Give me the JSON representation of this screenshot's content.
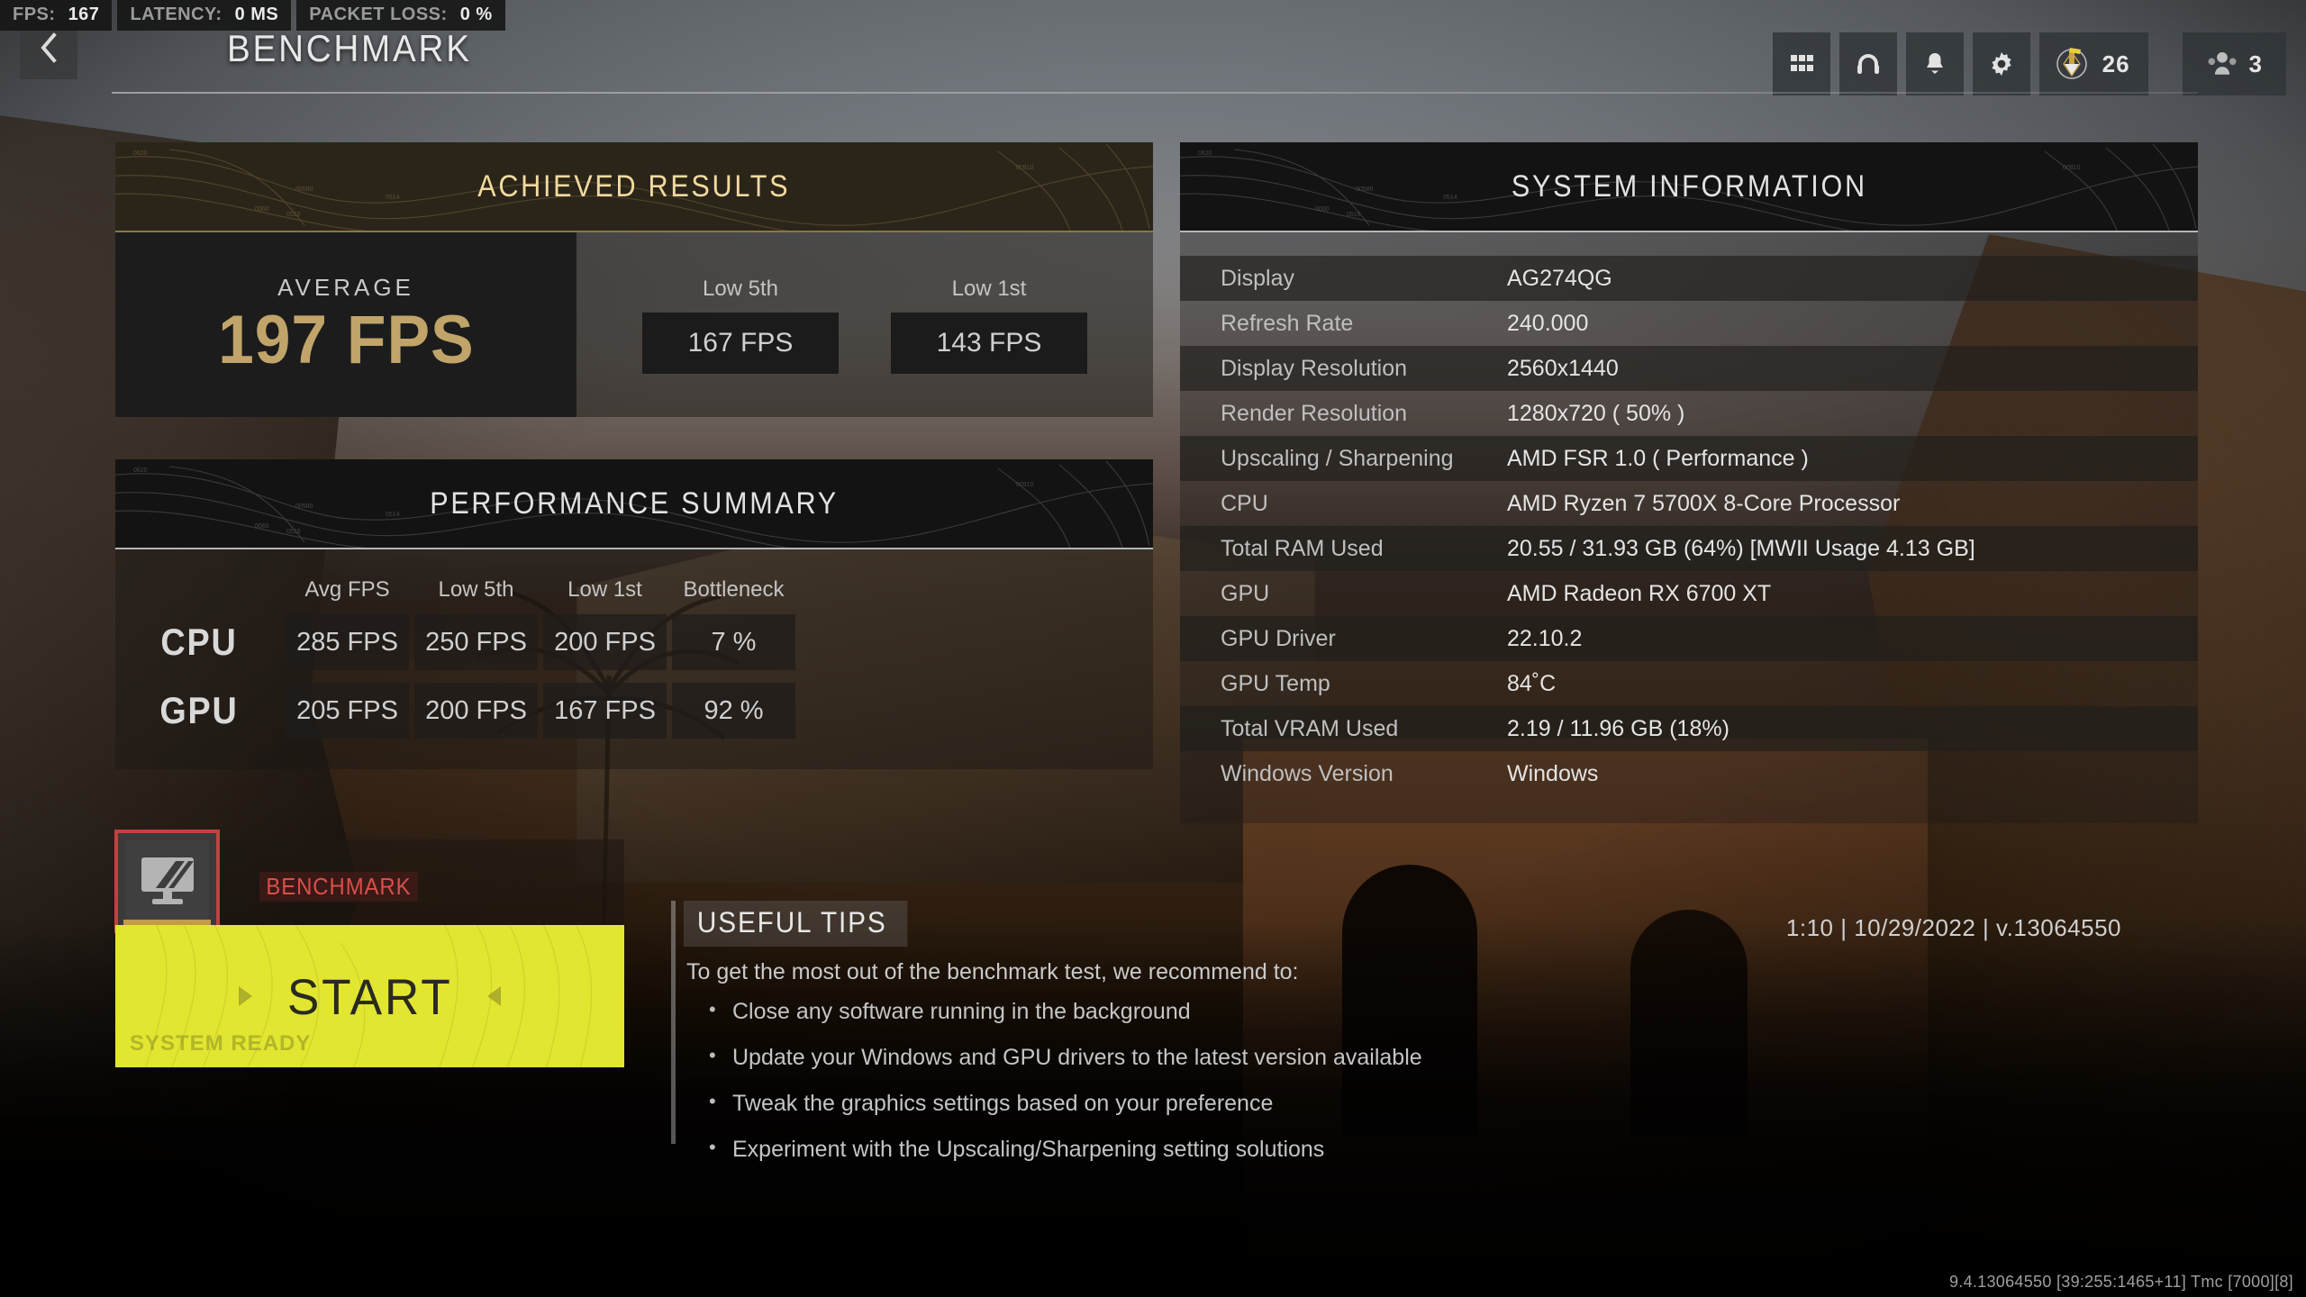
{
  "perf_hud": [
    {
      "label": "FPS:",
      "value": "167"
    },
    {
      "label": "LATENCY:",
      "value": "0 MS"
    },
    {
      "label": "PACKET LOSS:",
      "value": "0 %"
    }
  ],
  "header": {
    "title": "BENCHMARK",
    "back_icon": "chevron-left-icon",
    "icons": [
      {
        "name": "grid-apps-icon"
      },
      {
        "name": "headset-icon"
      },
      {
        "name": "bell-notification-icon"
      },
      {
        "name": "gear-settings-icon"
      }
    ],
    "battlepass": {
      "icon": "battlepass-token-icon",
      "count": "26"
    },
    "party": {
      "icon": "squad-player-icon",
      "count": "3"
    }
  },
  "achieved_results": {
    "title": "ACHIEVED RESULTS",
    "average_label": "AVERAGE",
    "average_value": "197 FPS",
    "lows": [
      {
        "label": "Low 5th",
        "value": "167 FPS"
      },
      {
        "label": "Low 1st",
        "value": "143 FPS"
      }
    ]
  },
  "performance_summary": {
    "title": "PERFORMANCE SUMMARY",
    "columns": [
      "Avg FPS",
      "Low 5th",
      "Low 1st",
      "Bottleneck"
    ],
    "rows": [
      {
        "label": "CPU",
        "values": [
          "285 FPS",
          "250 FPS",
          "200 FPS",
          "7 %"
        ]
      },
      {
        "label": "GPU",
        "values": [
          "205 FPS",
          "200 FPS",
          "167 FPS",
          "92 %"
        ]
      }
    ]
  },
  "system_information": {
    "title": "SYSTEM INFORMATION",
    "rows": [
      {
        "key": "Display",
        "value": "AG274QG"
      },
      {
        "key": "Refresh Rate",
        "value": "240.000"
      },
      {
        "key": "Display Resolution",
        "value": "2560x1440"
      },
      {
        "key": "Render Resolution",
        "value": "1280x720 ( 50% )"
      },
      {
        "key": "Upscaling / Sharpening",
        "value": "AMD FSR 1.0 ( Performance )"
      },
      {
        "key": "CPU",
        "value": "AMD Ryzen 7 5700X 8-Core Processor"
      },
      {
        "key": "Total RAM Used",
        "value": "20.55 / 31.93 GB (64%) [MWII Usage 4.13 GB]"
      },
      {
        "key": "GPU",
        "value": "AMD Radeon RX 6700 XT"
      },
      {
        "key": "GPU Driver",
        "value": "22.10.2"
      },
      {
        "key": "GPU Temp",
        "value": "84˚C"
      },
      {
        "key": "Total VRAM Used",
        "value": "2.19 / 11.96 GB (18%)"
      },
      {
        "key": "Windows Version",
        "value": "Windows"
      }
    ]
  },
  "benchmark_card": {
    "tag": "BENCHMARK",
    "thumb_icon": "benchmark-monitor-icon",
    "start_label": "START",
    "ready_watermark": "SYSTEM READY"
  },
  "useful_tips": {
    "title": "USEFUL TIPS",
    "intro": "To get the most out of the benchmark test, we recommend to:",
    "items": [
      "Close any software running in the background",
      "Update your Windows and GPU drivers to the latest version available",
      "Tweak the graphics settings based on your preference",
      "Experiment with the Upscaling/Sharpening setting solutions"
    ]
  },
  "run_meta": "1:10 | 10/29/2022 | v.13064550",
  "build_meta": "9.4.13064550 [39:255:1465+11] Tmc [7000][8]",
  "colors": {
    "accent_gold": "#c0a469",
    "title_gold": "#f2daa0",
    "start_yellow": "#e2e630",
    "tag_red": "#d94f4a",
    "panel_dark": "#1c1c1c"
  }
}
